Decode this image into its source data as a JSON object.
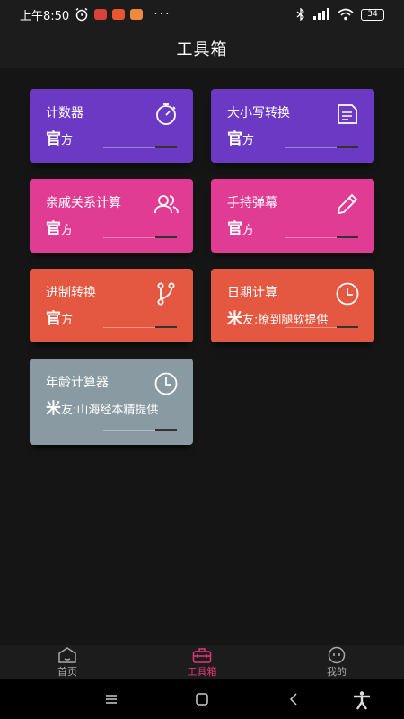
{
  "status": {
    "time": "上午8:50",
    "mini_icons": [
      "#d9413a",
      "#e8562e",
      "#f28a3e"
    ],
    "more": "···",
    "battery": "34"
  },
  "header": {
    "title": "工具箱"
  },
  "cards": [
    {
      "title": "计数器",
      "icon": "stopwatch-icon",
      "prefix": "官",
      "desc": "方"
    },
    {
      "title": "大小写转换",
      "icon": "document-icon",
      "prefix": "官",
      "desc": "方"
    },
    {
      "title": "亲戚关系计算",
      "icon": "users-icon",
      "prefix": "官",
      "desc": "方"
    },
    {
      "title": "手持弹幕",
      "icon": "pencil-icon",
      "prefix": "官",
      "desc": "方"
    },
    {
      "title": "进制转换",
      "icon": "branch-icon",
      "prefix": "官",
      "desc": "方"
    },
    {
      "title": "日期计算",
      "icon": "clock-icon",
      "prefix": "米",
      "desc": "友:撩到腿软提供"
    },
    {
      "title": "年龄计算器",
      "icon": "clock-icon",
      "prefix": "米",
      "desc": "友:山海经本精提供"
    }
  ],
  "tabs": [
    {
      "label": "首页",
      "icon": "home-icon",
      "active": false
    },
    {
      "label": "工具箱",
      "icon": "toolbox-icon",
      "active": true
    },
    {
      "label": "我的",
      "icon": "face-icon",
      "active": false
    }
  ],
  "colors": {
    "purple": "#6c39c4",
    "pink": "#e03c94",
    "orange": "#e45740",
    "grey": "#8a9aa2",
    "accent": "#e2367a"
  }
}
